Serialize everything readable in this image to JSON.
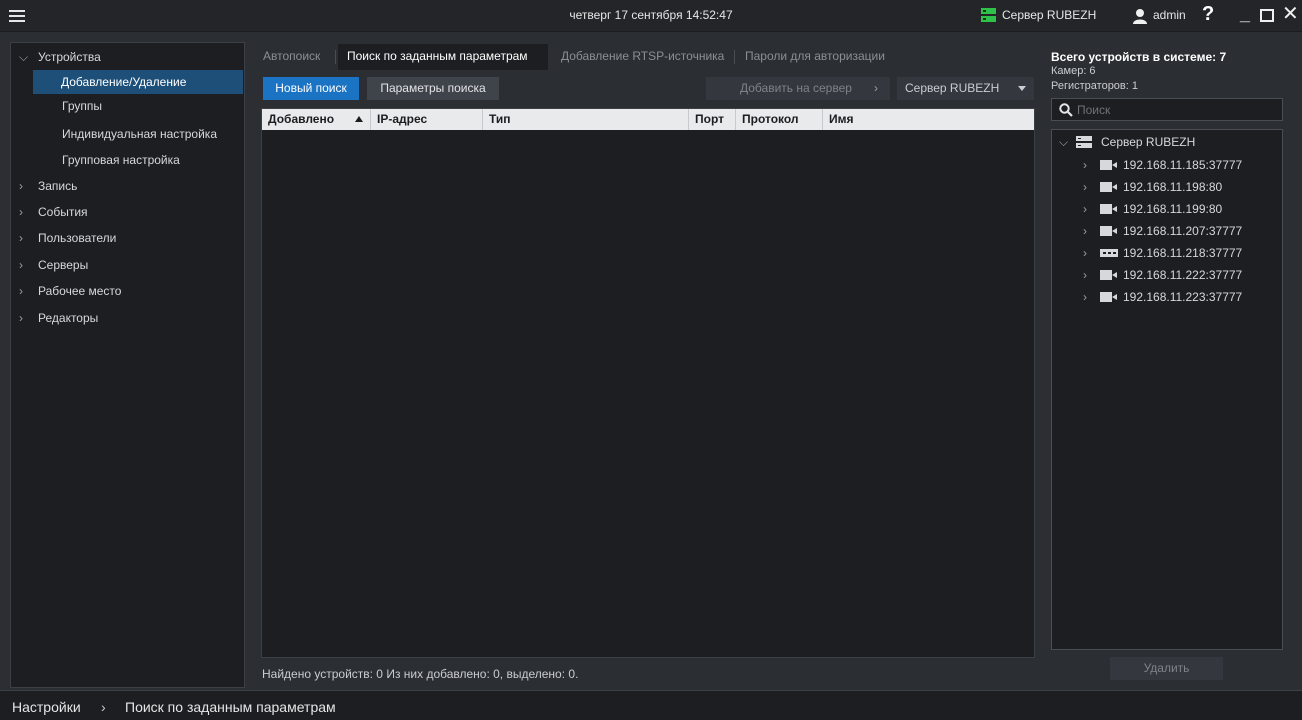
{
  "titlebar": {
    "datetime": "четверг 17 сентября 14:52:47",
    "server": "Сервер RUBEZH",
    "user": "admin",
    "help": "?"
  },
  "nav": {
    "items": [
      {
        "label": "Устройства",
        "expanded": true
      },
      {
        "label": "Добавление/Удаление",
        "active": true
      },
      {
        "label": "Группы"
      },
      {
        "label": "Индивидуальная настройка"
      },
      {
        "label": "Групповая настройка"
      },
      {
        "label": "Запись"
      },
      {
        "label": "События"
      },
      {
        "label": "Пользователи"
      },
      {
        "label": "Серверы"
      },
      {
        "label": "Рабочее место"
      },
      {
        "label": "Редакторы"
      }
    ]
  },
  "tabs": [
    {
      "label": "Автопоиск"
    },
    {
      "label": "Поиск по заданным параметрам",
      "active": true
    },
    {
      "label": "Добавление RTSP-источника"
    },
    {
      "label": "Пароли для авторизации"
    }
  ],
  "toolbar": {
    "new_search": "Новый поиск",
    "search_params": "Параметры поиска",
    "add_to_server": "Добавить на сервер",
    "server_select": "Сервер RUBEZH"
  },
  "grid": {
    "columns": [
      "Добавлено",
      "IP-адрес",
      "Тип",
      "Порт",
      "Протокол",
      "Имя"
    ],
    "rows": []
  },
  "status": {
    "found": "Найдено устройств: 0 Из них добавлено: 0, выделено: 0."
  },
  "right": {
    "total": "Всего устройств в системе: 7",
    "cameras": "Камер: 6",
    "recorders": "Регистраторов: 1",
    "search_placeholder": "Поиск",
    "server_node": "Сервер RUBEZH",
    "devices": [
      {
        "address": "192.168.11.185:37777",
        "icon": "camera-icon"
      },
      {
        "address": "192.168.11.198:80",
        "icon": "camera-icon"
      },
      {
        "address": "192.168.11.199:80",
        "icon": "camera-icon"
      },
      {
        "address": "192.168.11.207:37777",
        "icon": "camera-icon"
      },
      {
        "address": "192.168.11.218:37777",
        "icon": "recorder-icon"
      },
      {
        "address": "192.168.11.222:37777",
        "icon": "camera-icon"
      },
      {
        "address": "192.168.11.223:37777",
        "icon": "camera-icon"
      }
    ],
    "delete_label": "Удалить"
  },
  "breadcrumb": {
    "root": "Настройки",
    "current": "Поиск по заданным параметрам"
  },
  "colors": {
    "accent": "#1a73c3",
    "active_nav": "#1e4f79",
    "status_ok": "#2ec24a"
  }
}
